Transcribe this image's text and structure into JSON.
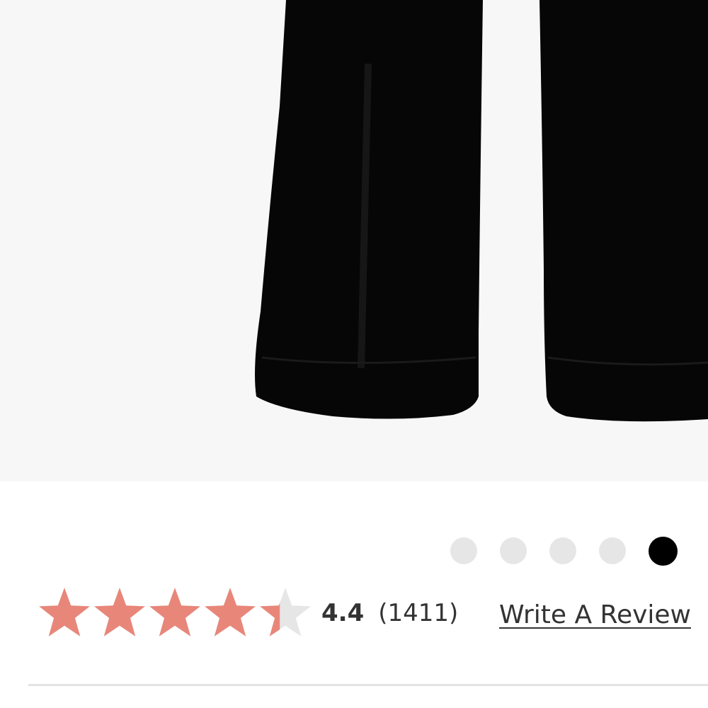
{
  "product": {
    "image_alt": "Black pants product image"
  },
  "carousel": {
    "dot_count": 5,
    "active_index": 4
  },
  "rating": {
    "value": "4.4",
    "value_number": 4.4,
    "max": 5,
    "count": "(1411)",
    "star_color": "#e8867a",
    "star_empty_color": "#e6e6e6"
  },
  "actions": {
    "write_review_label": "Write A Review"
  }
}
